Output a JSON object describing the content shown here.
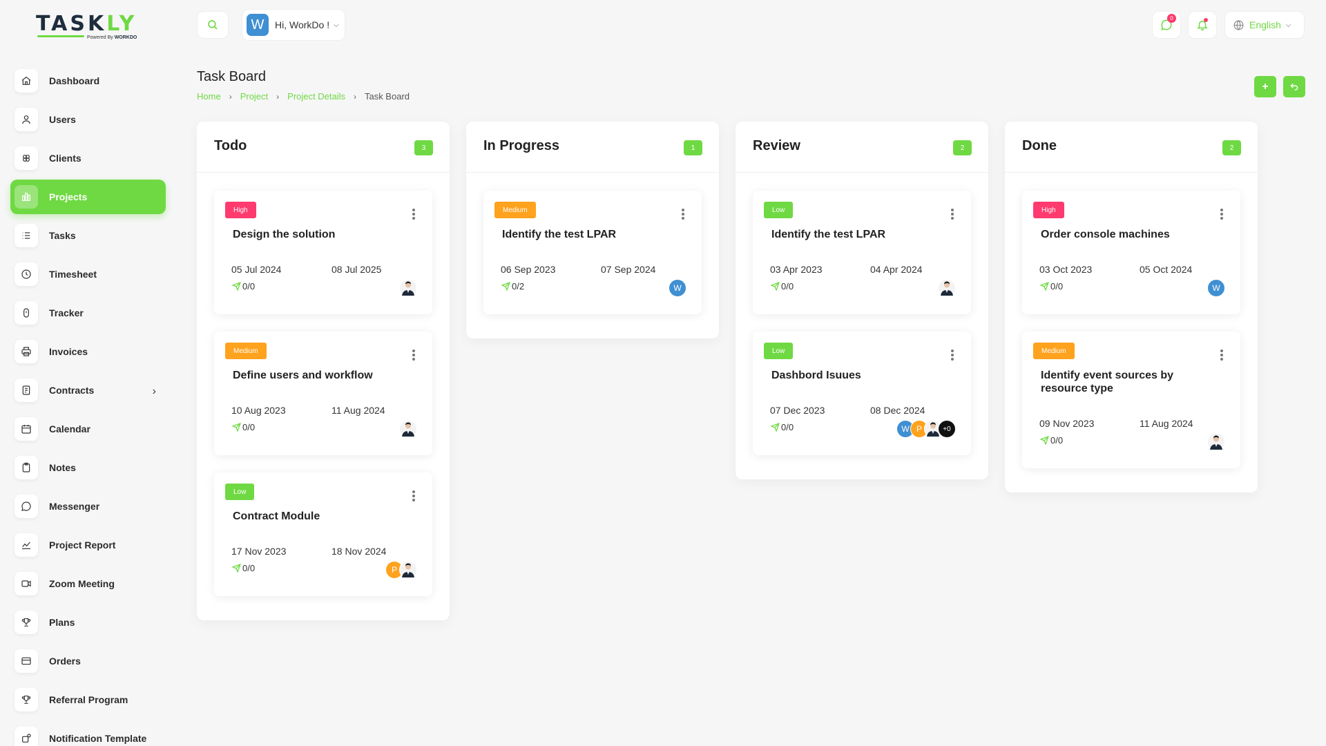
{
  "brand": {
    "name_a": "TASK",
    "name_b": "LY",
    "tagline": "Powered By",
    "tagline_brand": "WORKDO"
  },
  "sidebar": {
    "items": [
      {
        "label": "Dashboard",
        "icon": "home-icon"
      },
      {
        "label": "Users",
        "icon": "user-icon"
      },
      {
        "label": "Clients",
        "icon": "clients-icon"
      },
      {
        "label": "Projects",
        "icon": "projects-icon",
        "active": true
      },
      {
        "label": "Tasks",
        "icon": "list-icon"
      },
      {
        "label": "Timesheet",
        "icon": "clock-icon"
      },
      {
        "label": "Tracker",
        "icon": "tracker-icon"
      },
      {
        "label": "Invoices",
        "icon": "printer-icon"
      },
      {
        "label": "Contracts",
        "icon": "contract-icon"
      },
      {
        "label": "Calendar",
        "icon": "calendar-icon"
      },
      {
        "label": "Notes",
        "icon": "clipboard-icon"
      },
      {
        "label": "Messenger",
        "icon": "chat-icon"
      },
      {
        "label": "Project Report",
        "icon": "chart-icon"
      },
      {
        "label": "Zoom Meeting",
        "icon": "video-icon"
      },
      {
        "label": "Plans",
        "icon": "trophy-icon"
      },
      {
        "label": "Orders",
        "icon": "card-icon"
      },
      {
        "label": "Referral Program",
        "icon": "trophy-icon"
      },
      {
        "label": "Notification Template",
        "icon": "notification-icon"
      }
    ]
  },
  "header": {
    "user_initial": "W",
    "user_greeting": "Hi, WorkDo !",
    "messages_count": "0",
    "language": "English"
  },
  "page": {
    "title": "Task Board",
    "breadcrumb": [
      "Home",
      "Project",
      "Project Details",
      "Task Board"
    ]
  },
  "columns": [
    {
      "title": "Todo",
      "count": "3",
      "cards": [
        {
          "priority": "High",
          "title": "Design the solution",
          "start": "05 Jul 2024",
          "end": "08 Jul 2025",
          "tally": "0/0",
          "avatars": [
            "photo"
          ]
        },
        {
          "priority": "Medium",
          "title": "Define users and workflow",
          "start": "10 Aug 2023",
          "end": "11 Aug 2024",
          "tally": "0/0",
          "avatars": [
            "photo"
          ]
        },
        {
          "priority": "Low",
          "title": "Contract Module",
          "start": "17 Nov 2023",
          "end": "18 Nov 2024",
          "tally": "0/0",
          "avatars": [
            "P",
            "photo"
          ]
        }
      ]
    },
    {
      "title": "In Progress",
      "count": "1",
      "cards": [
        {
          "priority": "Medium",
          "title": "Identify the test LPAR",
          "start": "06 Sep 2023",
          "end": "07 Sep 2024",
          "tally": "0/2",
          "avatars": [
            "W"
          ]
        }
      ]
    },
    {
      "title": "Review",
      "count": "2",
      "cards": [
        {
          "priority": "Low",
          "title": "Identify the test LPAR",
          "start": "03 Apr 2023",
          "end": "04 Apr 2024",
          "tally": "0/0",
          "avatars": [
            "photo"
          ]
        },
        {
          "priority": "Low",
          "title": "Dashbord Isuues",
          "start": "07 Dec 2023",
          "end": "08 Dec 2024",
          "tally": "0/0",
          "avatars": [
            "W",
            "P",
            "photo",
            "+0"
          ]
        }
      ]
    },
    {
      "title": "Done",
      "count": "2",
      "cards": [
        {
          "priority": "High",
          "title": "Order console machines",
          "start": "03 Oct 2023",
          "end": "05 Oct 2024",
          "tally": "0/0",
          "avatars": [
            "W"
          ]
        },
        {
          "priority": "Medium",
          "title": "Identify event sources by resource type",
          "start": "09 Nov 2023",
          "end": "11 Aug 2024",
          "tally": "0/0",
          "avatars": [
            "photo"
          ]
        }
      ]
    }
  ],
  "colors": {
    "accent": "#6fd943",
    "high": "#ff3a6e",
    "medium": "#ffa21d",
    "low": "#6fd943",
    "avatar_w": "#3f8fd3"
  }
}
